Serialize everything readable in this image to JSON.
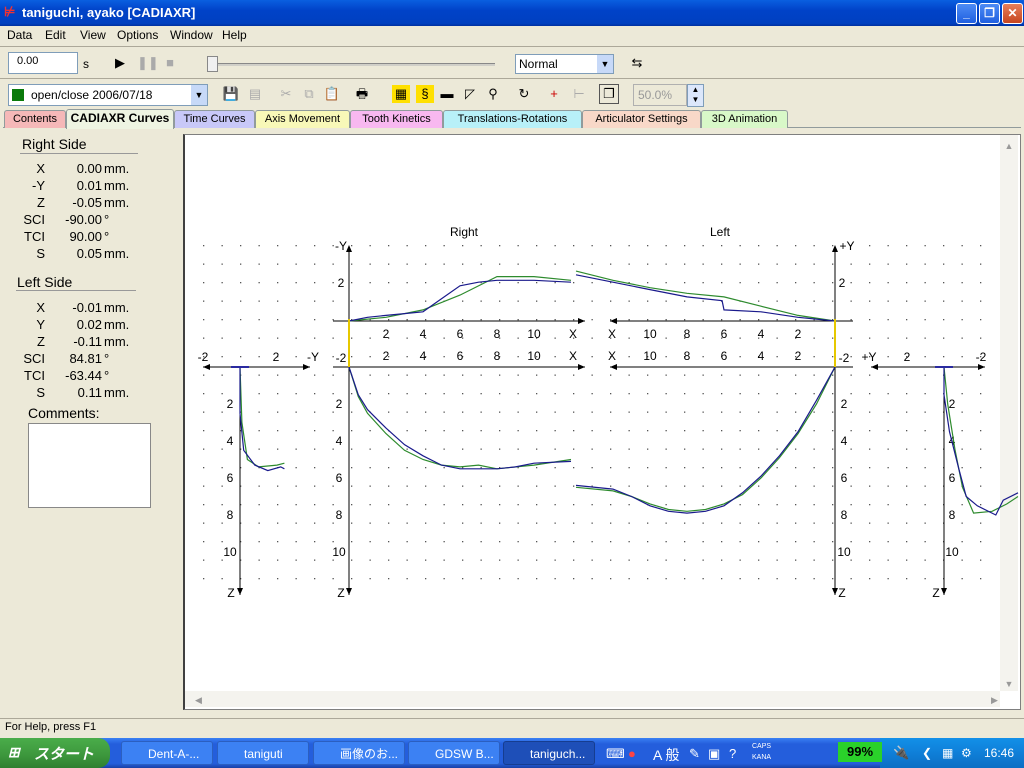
{
  "window": {
    "title": "taniguchi, ayako [CADIAXR]"
  },
  "menu": [
    "Data",
    "Edit",
    "View",
    "Options",
    "Window",
    "Help"
  ],
  "playback": {
    "time_value": "0.00",
    "time_unit": "s",
    "mode": "Normal"
  },
  "toolbar2": {
    "recording": "open/close 2006/07/18",
    "zoom": "50.0%"
  },
  "tabs": [
    {
      "label": "Contents",
      "color": "#f5b8b8"
    },
    {
      "label": "CADIAXR Curves",
      "color": "#eef4e2"
    },
    {
      "label": "Time Curves",
      "color": "#c8c8f8"
    },
    {
      "label": "Axis Movement",
      "color": "#f8f8b8"
    },
    {
      "label": "Tooth Kinetics",
      "color": "#f8b8f0"
    },
    {
      "label": "Translations-Rotations",
      "color": "#b8f0f8"
    },
    {
      "label": "Articulator Settings",
      "color": "#f8d8c8"
    },
    {
      "label": "3D Animation",
      "color": "#d8f8c8"
    }
  ],
  "left_panel": {
    "right_title": "Right Side",
    "right": [
      {
        "label": "X",
        "value": "0.00",
        "unit": "mm."
      },
      {
        "label": "-Y",
        "value": "0.01",
        "unit": "mm."
      },
      {
        "label": "Z",
        "value": "-0.05",
        "unit": "mm."
      },
      {
        "label": "SCI",
        "value": "-90.00",
        "unit": "°"
      },
      {
        "label": "TCI",
        "value": "90.00",
        "unit": "°"
      },
      {
        "label": "S",
        "value": "0.05",
        "unit": "mm."
      }
    ],
    "left_title": "Left Side",
    "left": [
      {
        "label": "X",
        "value": "-0.01",
        "unit": "mm."
      },
      {
        "label": "Y",
        "value": "0.02",
        "unit": "mm."
      },
      {
        "label": "Z",
        "value": "-0.11",
        "unit": "mm."
      },
      {
        "label": "SCI",
        "value": "84.81",
        "unit": "°"
      },
      {
        "label": "TCI",
        "value": "-63.44",
        "unit": "°"
      },
      {
        "label": "S",
        "value": "0.11",
        "unit": "mm."
      }
    ],
    "comments_label": "Comments:"
  },
  "chart_labels": {
    "right_title": "Right",
    "left_title": "Left",
    "neg_y": "-Y",
    "pos_y": "+Y",
    "x": "X",
    "z": "Z",
    "ticks_x": [
      "2",
      "4",
      "6",
      "8",
      "10"
    ],
    "ticks_x_left": [
      "10",
      "8",
      "6",
      "4",
      "2"
    ],
    "ticks_z": [
      "2",
      "4",
      "6",
      "8",
      "10"
    ],
    "side_neg": "-2",
    "side_pos": "2",
    "side_y2": "2",
    "side_neg2": "-2",
    "tick_2": "2"
  },
  "chart_data": {
    "type": "line",
    "series_colors": {
      "blue": "#1a1a8c",
      "green": "#2e8b2e"
    },
    "right_top": {
      "blue": [
        [
          0,
          0
        ],
        [
          1,
          0.2
        ],
        [
          2,
          0.3
        ],
        [
          3,
          0.4
        ],
        [
          4,
          0.5
        ],
        [
          5,
          1.2
        ],
        [
          6,
          1.9
        ],
        [
          7,
          2.1
        ],
        [
          8,
          2.2
        ],
        [
          9,
          2.2
        ],
        [
          10,
          2.2
        ],
        [
          12,
          2.1
        ]
      ],
      "green": [
        [
          0,
          0
        ],
        [
          2,
          0.2
        ],
        [
          4,
          0.6
        ],
        [
          6,
          1.4
        ],
        [
          8,
          2.4
        ],
        [
          10,
          2.4
        ],
        [
          12,
          2.2
        ]
      ]
    },
    "right_bottom": {
      "blue": [
        [
          0,
          0
        ],
        [
          0.5,
          1.5
        ],
        [
          1,
          2.3
        ],
        [
          2,
          3.3
        ],
        [
          3,
          4.2
        ],
        [
          4,
          4.8
        ],
        [
          5,
          5.3
        ],
        [
          6,
          5.5
        ],
        [
          7,
          5.5
        ],
        [
          8,
          5.5
        ],
        [
          9,
          5.4
        ],
        [
          10,
          5.2
        ],
        [
          12,
          5.1
        ]
      ],
      "green": [
        [
          0,
          0
        ],
        [
          0.5,
          1.6
        ],
        [
          1,
          2.5
        ],
        [
          2,
          3.6
        ],
        [
          3,
          4.5
        ],
        [
          4,
          5.0
        ],
        [
          5,
          5.3
        ],
        [
          6,
          5.4
        ],
        [
          7,
          5.3
        ],
        [
          8,
          5.5
        ],
        [
          10,
          5.3
        ],
        [
          12,
          5.0
        ]
      ]
    },
    "left_top": {
      "blue": [
        [
          0,
          0
        ],
        [
          2,
          0.2
        ],
        [
          4,
          0.5
        ],
        [
          6,
          0.6
        ],
        [
          6.1,
          1.1
        ],
        [
          8,
          1.3
        ],
        [
          10,
          1.7
        ],
        [
          12,
          2.1
        ],
        [
          14,
          2.5
        ]
      ],
      "green": [
        [
          0,
          0
        ],
        [
          2,
          0.3
        ],
        [
          4,
          0.8
        ],
        [
          6,
          1.3
        ],
        [
          8,
          1.5
        ],
        [
          10,
          1.8
        ],
        [
          12,
          2.2
        ],
        [
          14,
          2.7
        ]
      ]
    },
    "left_bottom": {
      "blue": [
        [
          0,
          0
        ],
        [
          1,
          1.8
        ],
        [
          2,
          3.5
        ],
        [
          3,
          4.8
        ],
        [
          4,
          5.9
        ],
        [
          5,
          6.8
        ],
        [
          6,
          7.5
        ],
        [
          7,
          7.8
        ],
        [
          8,
          7.9
        ],
        [
          9,
          7.8
        ],
        [
          10,
          7.5
        ],
        [
          11,
          7.0
        ],
        [
          12,
          6.6
        ],
        [
          14,
          6.4
        ]
      ],
      "green": [
        [
          0,
          0
        ],
        [
          1,
          2.0
        ],
        [
          2,
          3.6
        ],
        [
          3,
          4.9
        ],
        [
          4,
          6.0
        ],
        [
          5,
          6.9
        ],
        [
          6,
          7.4
        ],
        [
          7,
          7.7
        ],
        [
          8,
          7.8
        ],
        [
          9,
          7.7
        ],
        [
          10,
          7.4
        ],
        [
          11,
          7.0
        ],
        [
          12,
          6.7
        ],
        [
          14,
          6.5
        ]
      ]
    },
    "right_side": {
      "blue": [
        [
          0,
          0
        ],
        [
          0,
          2.5
        ],
        [
          0.2,
          4.5
        ],
        [
          0.8,
          5.3
        ],
        [
          1.5,
          5.6
        ],
        [
          2.2,
          5.4
        ],
        [
          2.4,
          5.5
        ]
      ],
      "green": [
        [
          0,
          0
        ],
        [
          0.1,
          3
        ],
        [
          0.4,
          5
        ],
        [
          1,
          5.4
        ],
        [
          2,
          5.3
        ],
        [
          2.4,
          5.2
        ]
      ]
    },
    "left_side": {
      "blue": [
        [
          0,
          0
        ],
        [
          0,
          1.5
        ],
        [
          0.3,
          3.5
        ],
        [
          0.8,
          5.5
        ],
        [
          1.2,
          7.0
        ],
        [
          1.8,
          7.5
        ],
        [
          2.8,
          8.0
        ],
        [
          3.2,
          7.2
        ],
        [
          4,
          6.8
        ]
      ],
      "green": [
        [
          0,
          0
        ],
        [
          0.2,
          2
        ],
        [
          0.6,
          4.5
        ],
        [
          1.0,
          6.5
        ],
        [
          1.6,
          7.9
        ],
        [
          2.6,
          7.8
        ],
        [
          3.4,
          7.4
        ],
        [
          4,
          7.0
        ]
      ]
    }
  },
  "status": {
    "help": "For Help, press F1"
  },
  "taskbar": {
    "start": "スタート",
    "items": [
      {
        "label": "Dent-A-...",
        "active": false
      },
      {
        "label": "taniguti",
        "active": false
      },
      {
        "label": "画像のお...",
        "active": false
      },
      {
        "label": "GDSW B...",
        "active": false
      },
      {
        "label": "taniguch...",
        "active": true
      }
    ],
    "ime": "A 般",
    "caps": "CAPS",
    "kana": "KANA",
    "battery": "99%",
    "clock": "16:46"
  }
}
